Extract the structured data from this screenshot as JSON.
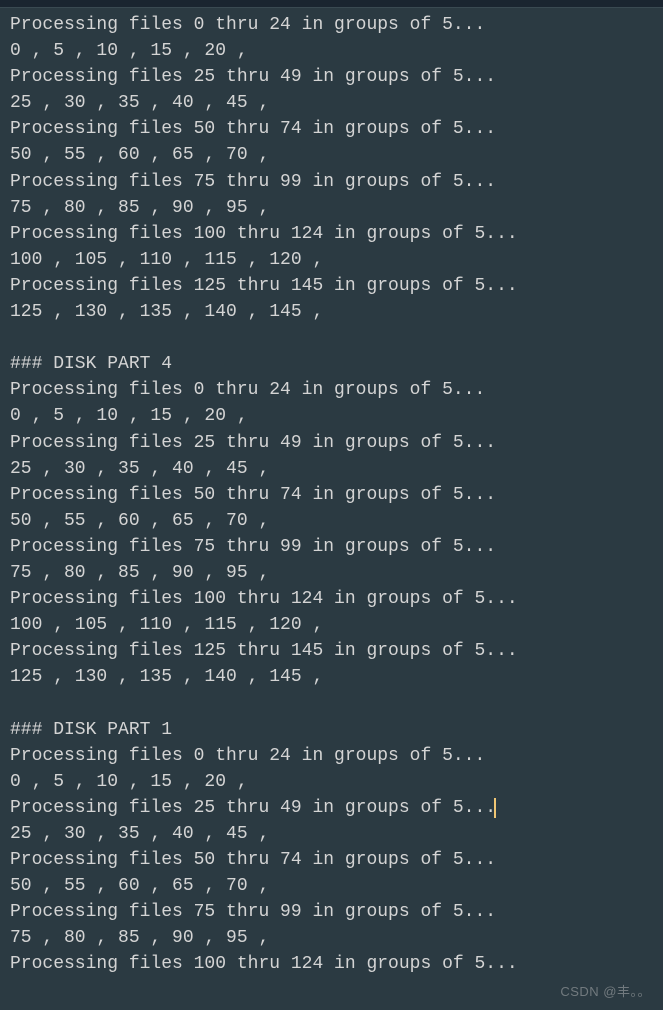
{
  "terminal": {
    "lines": [
      "Processing files 0 thru 24 in groups of 5...",
      "0 , 5 , 10 , 15 , 20 , ",
      "Processing files 25 thru 49 in groups of 5...",
      "25 , 30 , 35 , 40 , 45 , ",
      "Processing files 50 thru 74 in groups of 5...",
      "50 , 55 , 60 , 65 , 70 , ",
      "Processing files 75 thru 99 in groups of 5...",
      "75 , 80 , 85 , 90 , 95 , ",
      "Processing files 100 thru 124 in groups of 5...",
      "100 , 105 , 110 , 115 , 120 , ",
      "Processing files 125 thru 145 in groups of 5...",
      "125 , 130 , 135 , 140 , 145 , ",
      "",
      "### DISK PART 4",
      "Processing files 0 thru 24 in groups of 5...",
      "0 , 5 , 10 , 15 , 20 , ",
      "Processing files 25 thru 49 in groups of 5...",
      "25 , 30 , 35 , 40 , 45 , ",
      "Processing files 50 thru 74 in groups of 5...",
      "50 , 55 , 60 , 65 , 70 , ",
      "Processing files 75 thru 99 in groups of 5...",
      "75 , 80 , 85 , 90 , 95 , ",
      "Processing files 100 thru 124 in groups of 5...",
      "100 , 105 , 110 , 115 , 120 , ",
      "Processing files 125 thru 145 in groups of 5...",
      "125 , 130 , 135 , 140 , 145 , ",
      "",
      "### DISK PART 1",
      "Processing files 0 thru 24 in groups of 5...",
      "0 , 5 , 10 , 15 , 20 , ",
      "Processing files 25 thru 49 in groups of 5...",
      "25 , 30 , 35 , 40 , 45 , ",
      "Processing files 50 thru 74 in groups of 5...",
      "50 , 55 , 60 , 65 , 70 , ",
      "Processing files 75 thru 99 in groups of 5...",
      "75 , 80 , 85 , 90 , 95 , ",
      "Processing files 100 thru 124 in groups of 5..."
    ],
    "cursor_line_index": 30
  },
  "watermark": "CSDN @丰。。"
}
